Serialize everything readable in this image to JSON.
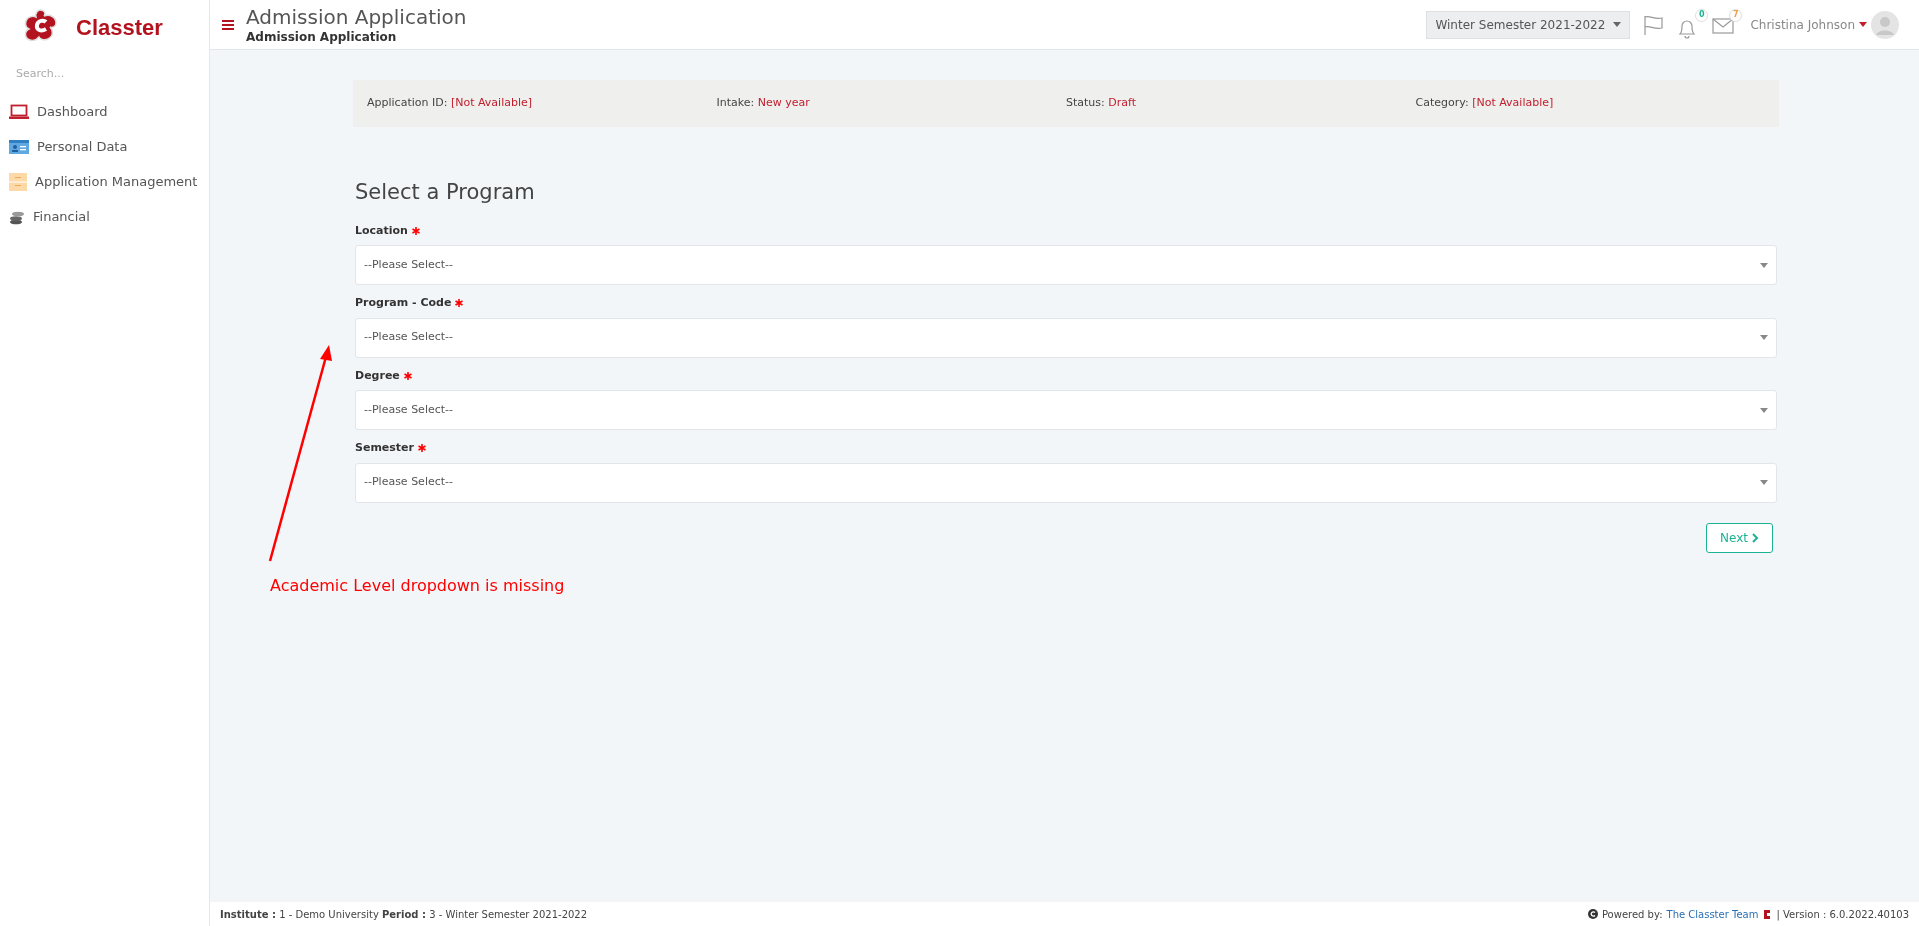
{
  "brand": {
    "name": "Classter"
  },
  "sidebar": {
    "search": {
      "placeholder": "Search..."
    },
    "items": [
      {
        "label": "Dashboard",
        "kind": "laptop"
      },
      {
        "label": "Personal Data",
        "kind": "card"
      },
      {
        "label": "Application Management",
        "kind": "folder"
      },
      {
        "label": "Financial",
        "kind": "coins"
      }
    ]
  },
  "header": {
    "title": "Admission Application",
    "subtitle": "Admission Application",
    "period": "Winter Semester 2021-2022",
    "notifications": "0",
    "messages": "7",
    "user": "Christina Johnson"
  },
  "info_bar": [
    {
      "label": "Application ID:",
      "value": "[Not Available]"
    },
    {
      "label": "Intake:",
      "value": "New year"
    },
    {
      "label": "Status:",
      "value": "Draft"
    },
    {
      "label": "Category:",
      "value": "[Not Available]"
    }
  ],
  "form": {
    "title": "Select a Program",
    "fields": [
      {
        "label": "Location",
        "required": true,
        "value": "--Please Select--"
      },
      {
        "label": "Program - Code",
        "required": true,
        "value": "--Please Select--"
      },
      {
        "label": "Degree",
        "required": true,
        "value": "--Please Select--"
      },
      {
        "label": "Semester",
        "required": true,
        "value": "--Please Select--"
      }
    ],
    "next_button": "Next"
  },
  "annotation": {
    "text": "Academic Level dropdown is missing"
  },
  "footer": {
    "context": "**Institute :** 1 - Demo University **Period :** 3 - Winter Semester 2021-2022",
    "powered_by": "Powered by:",
    "team_link": "The Classter Team",
    "version": "| Version : 6.0.2022.40103"
  }
}
